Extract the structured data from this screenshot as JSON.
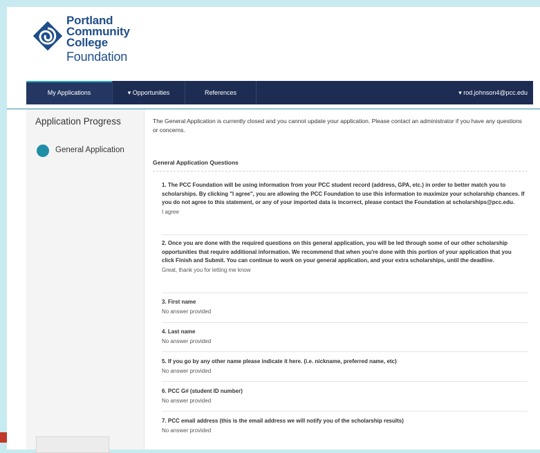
{
  "logo": {
    "line1": "Portland",
    "line2": "Communit",
    "line2_tail": "y",
    "line3": "College",
    "line4": "Foundation"
  },
  "nav": {
    "my_applications": "My Applications",
    "opportunities": "▾ Opportunities",
    "references": "References",
    "user": "▾ rod.johnson4@pcc.edu"
  },
  "sidebar": {
    "title": "Application Progress",
    "item": "General Application"
  },
  "main": {
    "notice": "The General Application is currently closed and you cannot update your application. Please contact an administrator if you have any questions or concerns.",
    "section_title": "General Application Questions",
    "questions": [
      {
        "title": "1. The PCC Foundation will be using information from your PCC student record (address, GPA, etc.) in order to better match you to scholarships. By clicking \"I agree\", you are allowing the PCC Foundation to use this information to maximize your scholarship chances. If you do not agree to this statement, or any of your imported data is incorrect, please contact the Foundation at scholarships@pcc.edu.",
        "answer": "I agree"
      },
      {
        "title": "2. Once you are done with the required questions on this general application, you will be led through some of our other scholarship opportunities that require additional information. We recommend that when you're done with this portion of your application that you click Finish and Submit. You can continue to work on your general application, and your extra scholarships, until the deadline.",
        "answer": "Great, thank you for letting me know"
      },
      {
        "title": "3. First name",
        "answer": "No answer provided"
      },
      {
        "title": "4. Last name",
        "answer": "No answer provided"
      },
      {
        "title": "5. If you go by any other name please indicate it here. (i.e. nickname, preferred name, etc)",
        "answer": "No answer provided"
      },
      {
        "title": "6. PCC G# (student ID number)",
        "answer": "No answer provided"
      },
      {
        "title": "7. PCC email address (this is the email address we will notify you of the scholarship results)",
        "answer": "No answer provided"
      }
    ]
  },
  "colors": {
    "navbar": "#1d2c52",
    "accent": "#1f8fa6",
    "brand": "#1f4e89",
    "background": "#c8eaf1"
  }
}
